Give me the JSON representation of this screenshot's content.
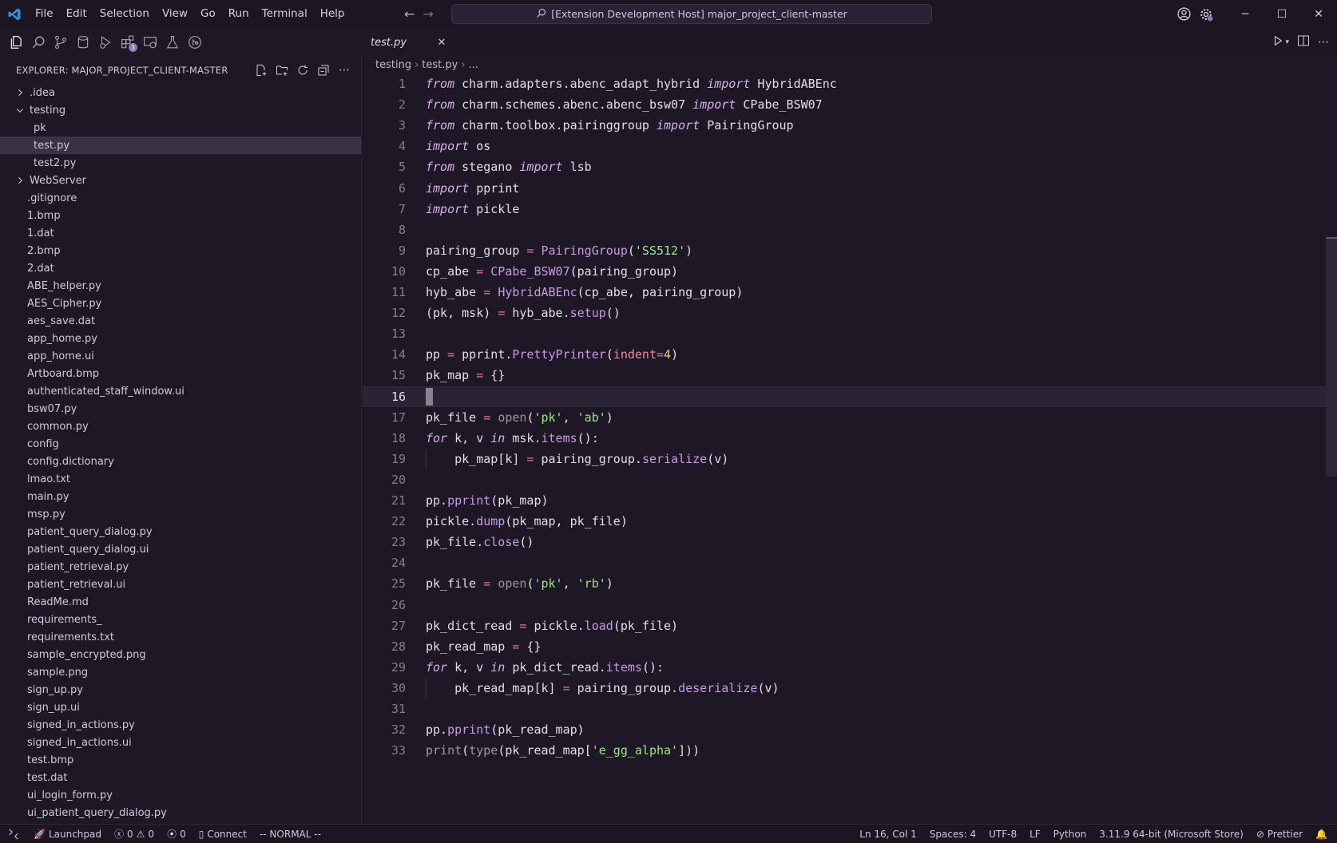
{
  "app": {
    "menu": [
      "File",
      "Edit",
      "Selection",
      "View",
      "Go",
      "Run",
      "Terminal",
      "Help"
    ],
    "command_center": "[Extension Development Host] major_project_client-master"
  },
  "activity": {
    "badges": {
      "extensions": "3"
    }
  },
  "explorer": {
    "title": "EXPLORER: MAJOR_PROJECT_CLIENT-MASTER",
    "tree": [
      {
        "label": ".idea",
        "type": "folder",
        "expanded": false
      },
      {
        "label": "testing",
        "type": "folder",
        "expanded": true
      },
      {
        "label": "pk",
        "type": "file",
        "depth": 1
      },
      {
        "label": "test.py",
        "type": "file",
        "depth": 1,
        "selected": true
      },
      {
        "label": "test2.py",
        "type": "file",
        "depth": 1
      },
      {
        "label": "WebServer",
        "type": "folder",
        "expanded": false
      },
      {
        "label": ".gitignore",
        "type": "file"
      },
      {
        "label": "1.bmp",
        "type": "file"
      },
      {
        "label": "1.dat",
        "type": "file"
      },
      {
        "label": "2.bmp",
        "type": "file"
      },
      {
        "label": "2.dat",
        "type": "file"
      },
      {
        "label": "ABE_helper.py",
        "type": "file"
      },
      {
        "label": "AES_Cipher.py",
        "type": "file"
      },
      {
        "label": "aes_save.dat",
        "type": "file"
      },
      {
        "label": "app_home.py",
        "type": "file"
      },
      {
        "label": "app_home.ui",
        "type": "file"
      },
      {
        "label": "Artboard.bmp",
        "type": "file"
      },
      {
        "label": "authenticated_staff_window.ui",
        "type": "file"
      },
      {
        "label": "bsw07.py",
        "type": "file"
      },
      {
        "label": "common.py",
        "type": "file"
      },
      {
        "label": "config",
        "type": "file"
      },
      {
        "label": "config.dictionary",
        "type": "file"
      },
      {
        "label": "lmao.txt",
        "type": "file"
      },
      {
        "label": "main.py",
        "type": "file"
      },
      {
        "label": "msp.py",
        "type": "file"
      },
      {
        "label": "patient_query_dialog.py",
        "type": "file"
      },
      {
        "label": "patient_query_dialog.ui",
        "type": "file"
      },
      {
        "label": "patient_retrieval.py",
        "type": "file"
      },
      {
        "label": "patient_retrieval.ui",
        "type": "file"
      },
      {
        "label": "ReadMe.md",
        "type": "file"
      },
      {
        "label": "requirements_",
        "type": "file"
      },
      {
        "label": "requirements.txt",
        "type": "file"
      },
      {
        "label": "sample_encrypted.png",
        "type": "file"
      },
      {
        "label": "sample.png",
        "type": "file"
      },
      {
        "label": "sign_up.py",
        "type": "file"
      },
      {
        "label": "sign_up.ui",
        "type": "file"
      },
      {
        "label": "signed_in_actions.py",
        "type": "file"
      },
      {
        "label": "signed_in_actions.ui",
        "type": "file"
      },
      {
        "label": "test.bmp",
        "type": "file"
      },
      {
        "label": "test.dat",
        "type": "file"
      },
      {
        "label": "ui_login_form.py",
        "type": "file"
      },
      {
        "label": "ui_patient_query_dialog.py",
        "type": "file"
      }
    ]
  },
  "editor": {
    "tab_label": "test.py",
    "breadcrumb": [
      "testing",
      "test.py",
      "..."
    ],
    "current_line": 16,
    "lines": [
      [
        [
          "kw",
          "from"
        ],
        [
          "t",
          " charm.adapters.abenc_adapt_hybrid "
        ],
        [
          "kw",
          "import"
        ],
        [
          "t",
          " HybridABEnc"
        ]
      ],
      [
        [
          "kw",
          "from"
        ],
        [
          "t",
          " charm.schemes.abenc.abenc_bsw07 "
        ],
        [
          "kw",
          "import"
        ],
        [
          "t",
          " CPabe_BSW07"
        ]
      ],
      [
        [
          "kw",
          "from"
        ],
        [
          "t",
          " charm.toolbox.pairinggroup "
        ],
        [
          "kw",
          "import"
        ],
        [
          "t",
          " PairingGroup"
        ]
      ],
      [
        [
          "kw",
          "import"
        ],
        [
          "t",
          " os"
        ]
      ],
      [
        [
          "kw",
          "from"
        ],
        [
          "t",
          " stegano "
        ],
        [
          "kw",
          "import"
        ],
        [
          "t",
          " lsb"
        ]
      ],
      [
        [
          "kw",
          "import"
        ],
        [
          "t",
          " pprint"
        ]
      ],
      [
        [
          "kw",
          "import"
        ],
        [
          "t",
          " pickle"
        ]
      ],
      [],
      [
        [
          "t",
          "pairing_group "
        ],
        [
          "op",
          "="
        ],
        [
          "t",
          " "
        ],
        [
          "fn",
          "PairingGroup"
        ],
        [
          "t",
          "("
        ],
        [
          "str",
          "'SS512'"
        ],
        [
          "t",
          ")"
        ]
      ],
      [
        [
          "t",
          "cp_abe "
        ],
        [
          "op",
          "="
        ],
        [
          "t",
          " "
        ],
        [
          "fn",
          "CPabe_BSW07"
        ],
        [
          "t",
          "(pairing_group)"
        ]
      ],
      [
        [
          "t",
          "hyb_abe "
        ],
        [
          "op",
          "="
        ],
        [
          "t",
          " "
        ],
        [
          "fn",
          "HybridABEnc"
        ],
        [
          "t",
          "(cp_abe, pairing_group)"
        ]
      ],
      [
        [
          "t",
          "(pk, msk) "
        ],
        [
          "op",
          "="
        ],
        [
          "t",
          " hyb_abe."
        ],
        [
          "fn",
          "setup"
        ],
        [
          "t",
          "()"
        ]
      ],
      [],
      [
        [
          "t",
          "pp "
        ],
        [
          "op",
          "="
        ],
        [
          "t",
          " pprint."
        ],
        [
          "fn",
          "PrettyPrinter"
        ],
        [
          "t",
          "("
        ],
        [
          "param",
          "indent"
        ],
        [
          "op",
          "="
        ],
        [
          "num",
          "4"
        ],
        [
          "t",
          ")"
        ]
      ],
      [
        [
          "t",
          "pk_map "
        ],
        [
          "op",
          "="
        ],
        [
          "t",
          " {}"
        ]
      ],
      [],
      [
        [
          "t",
          "pk_file "
        ],
        [
          "op",
          "="
        ],
        [
          "t",
          " "
        ],
        [
          "builtin",
          "open"
        ],
        [
          "t",
          "("
        ],
        [
          "str",
          "'pk'"
        ],
        [
          "t",
          ", "
        ],
        [
          "str",
          "'ab'"
        ],
        [
          "t",
          ")"
        ]
      ],
      [
        [
          "kw",
          "for"
        ],
        [
          "t",
          " k, v "
        ],
        [
          "kw",
          "in"
        ],
        [
          "t",
          " msk."
        ],
        [
          "fn",
          "items"
        ],
        [
          "t",
          "():"
        ]
      ],
      [
        [
          "t",
          "    pk_map[k] "
        ],
        [
          "op",
          "="
        ],
        [
          "t",
          " pairing_group."
        ],
        [
          "fn",
          "serialize"
        ],
        [
          "t",
          "(v)"
        ]
      ],
      [],
      [
        [
          "t",
          "pp."
        ],
        [
          "fn",
          "pprint"
        ],
        [
          "t",
          "(pk_map)"
        ]
      ],
      [
        [
          "t",
          "pickle."
        ],
        [
          "fn",
          "dump"
        ],
        [
          "t",
          "(pk_map, pk_file)"
        ]
      ],
      [
        [
          "t",
          "pk_file."
        ],
        [
          "fn",
          "close"
        ],
        [
          "t",
          "()"
        ]
      ],
      [],
      [
        [
          "t",
          "pk_file "
        ],
        [
          "op",
          "="
        ],
        [
          "t",
          " "
        ],
        [
          "builtin",
          "open"
        ],
        [
          "t",
          "("
        ],
        [
          "str",
          "'pk'"
        ],
        [
          "t",
          ", "
        ],
        [
          "str",
          "'rb'"
        ],
        [
          "t",
          ")"
        ]
      ],
      [],
      [
        [
          "t",
          "pk_dict_read "
        ],
        [
          "op",
          "="
        ],
        [
          "t",
          " pickle."
        ],
        [
          "fn",
          "load"
        ],
        [
          "t",
          "(pk_file)"
        ]
      ],
      [
        [
          "t",
          "pk_read_map "
        ],
        [
          "op",
          "="
        ],
        [
          "t",
          " {}"
        ]
      ],
      [
        [
          "kw",
          "for"
        ],
        [
          "t",
          " k, v "
        ],
        [
          "kw",
          "in"
        ],
        [
          "t",
          " pk_dict_read."
        ],
        [
          "fn",
          "items"
        ],
        [
          "t",
          "():"
        ]
      ],
      [
        [
          "t",
          "    pk_read_map[k] "
        ],
        [
          "op",
          "="
        ],
        [
          "t",
          " pairing_group."
        ],
        [
          "fn",
          "deserialize"
        ],
        [
          "t",
          "(v)"
        ]
      ],
      [],
      [
        [
          "t",
          "pp."
        ],
        [
          "fn",
          "pprint"
        ],
        [
          "t",
          "(pk_read_map)"
        ]
      ],
      [
        [
          "builtin",
          "print"
        ],
        [
          "t",
          "("
        ],
        [
          "builtin",
          "type"
        ],
        [
          "t",
          "(pk_read_map["
        ],
        [
          "str",
          "'e_gg_alpha'"
        ],
        [
          "t",
          "]))"
        ]
      ]
    ]
  },
  "status": {
    "launchpad": "Launchpad",
    "errors": "0",
    "warnings": "0",
    "ports": "0",
    "connect": "Connect",
    "mode": "-- NORMAL --",
    "position": "Ln 16, Col 1",
    "spaces": "Spaces: 4",
    "encoding": "UTF-8",
    "eol": "LF",
    "language": "Python",
    "interpreter": "3.11.9 64-bit (Microsoft Store)",
    "formatter": "Prettier"
  }
}
